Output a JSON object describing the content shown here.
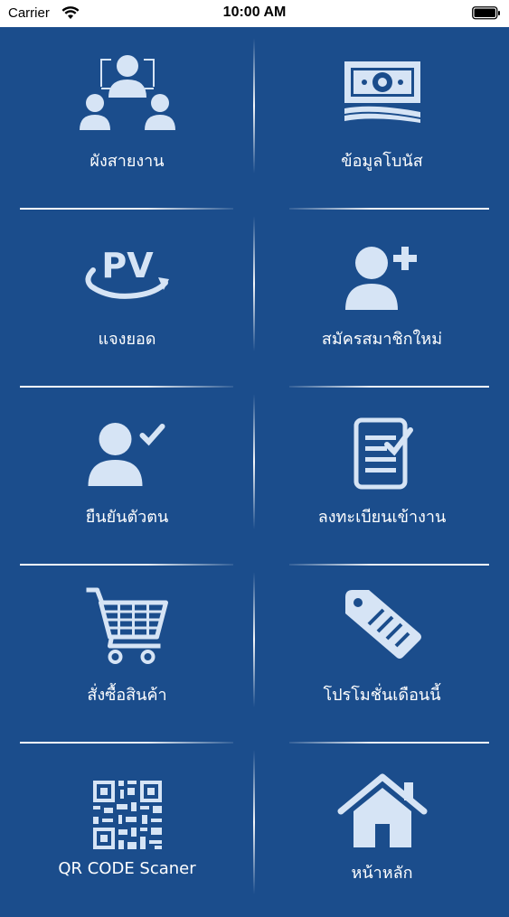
{
  "status_bar": {
    "carrier": "Carrier",
    "time": "10:00 AM"
  },
  "colors": {
    "background": "#1b4d8c",
    "icon_fill": "#d6e4f5",
    "text": "#ffffff"
  },
  "menu": {
    "items": [
      {
        "label": "ผังสายงาน",
        "icon": "org-chart-icon"
      },
      {
        "label": "ข้อมูลโบนัส",
        "icon": "money-icon"
      },
      {
        "label": "แจงยอด",
        "icon": "pv-rotate-icon"
      },
      {
        "label": "สมัครสมาชิกใหม่",
        "icon": "add-user-icon"
      },
      {
        "label": "ยืนยันตัวตน",
        "icon": "verify-user-icon"
      },
      {
        "label": "ลงทะเบียนเข้างาน",
        "icon": "checklist-document-icon"
      },
      {
        "label": "สั่งซื้อสินค้า",
        "icon": "shopping-cart-icon"
      },
      {
        "label": "โปรโมชั่นเดือนนี้",
        "icon": "price-tag-icon"
      },
      {
        "label": "QR CODE Scaner",
        "icon": "qr-code-icon"
      },
      {
        "label": "หน้าหลัก",
        "icon": "home-icon"
      }
    ],
    "pv_text": "PV"
  }
}
